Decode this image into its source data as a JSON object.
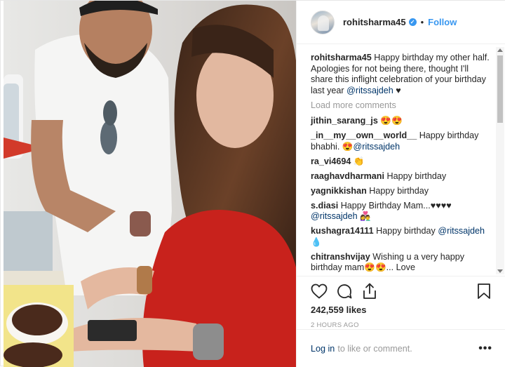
{
  "header": {
    "username": "rohitsharma45",
    "follow_label": "Follow",
    "separator": "•",
    "verified_glyph": "✓"
  },
  "caption": {
    "username": "rohitsharma45",
    "text": " Happy birthday my other half. Apologies for not being there, thought I'll share this inflight celebration of your birthday last year ",
    "mention": "@ritssajdeh",
    "suffix": " ♥"
  },
  "load_more_label": "Load more comments",
  "comments": [
    {
      "username": "jithin_sarang_js",
      "text": " 😍😍",
      "mention": "",
      "suffix": ""
    },
    {
      "username": "_in__my__own__world__",
      "text": " Happy birthday bhabhi. 😍",
      "mention": "@ritssajdeh",
      "suffix": ""
    },
    {
      "username": "ra_vi4694",
      "text": " 👏",
      "mention": "",
      "suffix": ""
    },
    {
      "username": "raaghavdharmani",
      "text": " Happy birthday",
      "mention": "",
      "suffix": ""
    },
    {
      "username": "yagnikkishan",
      "text": " Happy birthday",
      "mention": "",
      "suffix": ""
    },
    {
      "username": "s.diasi",
      "text": " Happy Birthday Mam...♥♥♥♥ ",
      "mention": "@ritssajdeh",
      "suffix": " 👩‍❤️‍👨"
    },
    {
      "username": "kushagra14111",
      "text": " Happy birthday ",
      "mention": "@ritssajdeh",
      "suffix": " 💧"
    },
    {
      "username": "chitranshvijay",
      "text": " Wishing u a very happy birthday mam😍😍... Love",
      "mention": "",
      "suffix": ""
    }
  ],
  "likes": "242,559 likes",
  "time": "2 HOURS AGO",
  "footer": {
    "login_label": "Log in",
    "rest_text": "to like or comment.",
    "more_label": "•••"
  },
  "icons": {
    "like": "heart-icon",
    "comment": "comment-bubble-icon",
    "share": "share-icon",
    "save": "bookmark-icon"
  },
  "colors": {
    "link_blue": "#3897f0",
    "mention_navy": "#003569",
    "muted_gray": "#999999",
    "text": "#262626"
  }
}
